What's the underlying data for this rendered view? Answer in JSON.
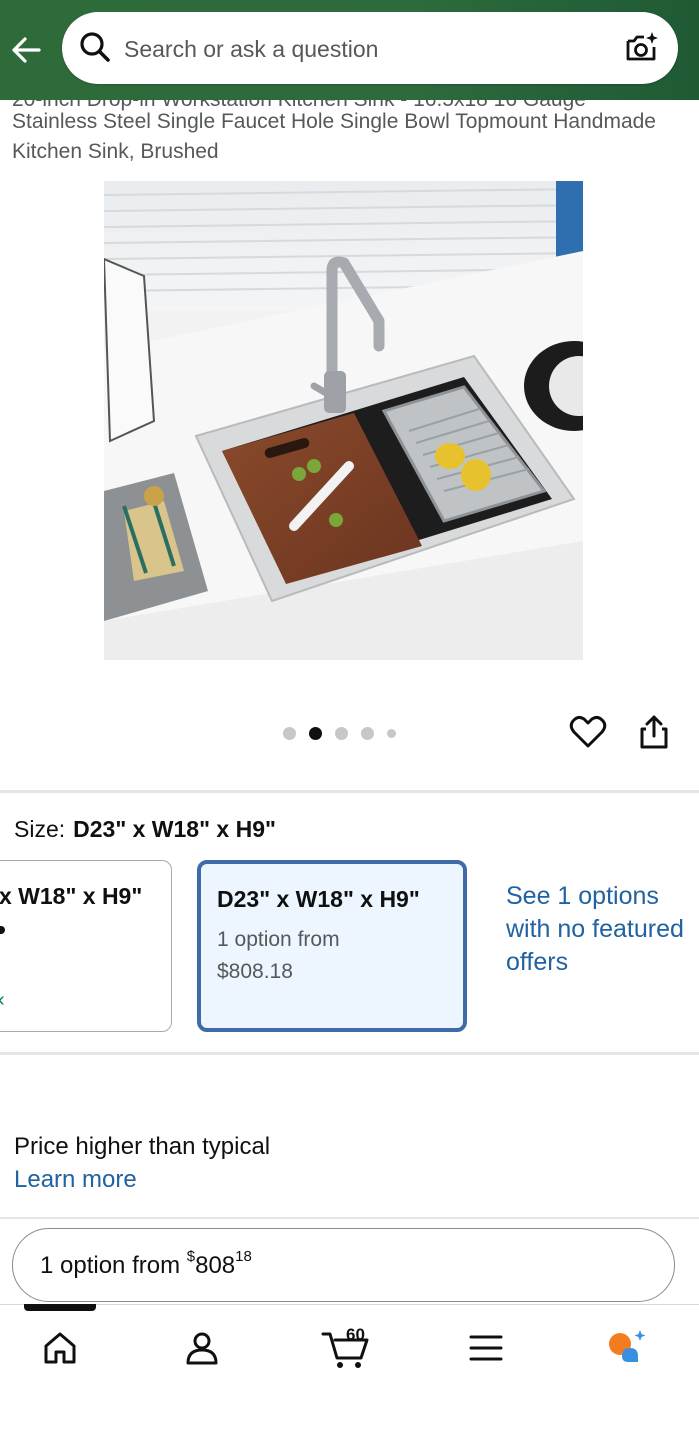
{
  "header": {
    "search_placeholder": "Search or ask a question",
    "back_icon": "arrow-left-icon",
    "camera_icon": "camera-sparkle-icon",
    "bg_color": "#2d6a3c"
  },
  "product": {
    "title_cut_line": "20-inch Drop-in Workstation Kitchen Sink - 16.5x18 16 Gauge",
    "title": "Stainless Steel Single Faucet Hole Single Bowl Topmount Handmade Kitchen Sink, Brushed",
    "image_count": 5,
    "active_image": 2
  },
  "actions": {
    "wishlist_icon": "heart-icon",
    "share_icon": "share-icon"
  },
  "size": {
    "label": "Size:",
    "selected_value": "D23\" x W18\" x H9\"",
    "prev_card": {
      "dim": "x W18\" x H9\""
    },
    "selected_card": {
      "dim": "D23\" x W18\" x H9\"",
      "line1": "1 option from",
      "line2": "$808.18"
    },
    "see_more": "See 1 options with no featured offers"
  },
  "price_notice": {
    "text": "Price higher than typical",
    "link": "Learn more"
  },
  "option_button": {
    "prefix": "1 option from ",
    "currency": "$",
    "dollars": "808",
    "cents": "18"
  },
  "bottom_nav": {
    "items": [
      "home-icon",
      "account-icon",
      "cart-icon",
      "menu-icon",
      "rufus-icon"
    ],
    "cart_count": "60"
  },
  "colors": {
    "link": "#2162a1",
    "selected_border": "#3f6ba9",
    "selected_bg": "#edf5fe",
    "rufus_orange": "#f47c20",
    "rufus_blue": "#3b8fe0"
  }
}
